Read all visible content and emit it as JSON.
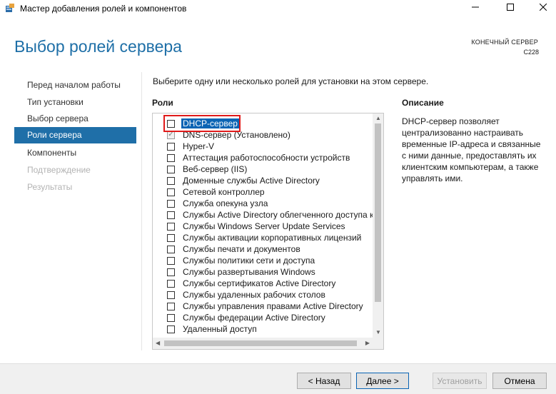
{
  "window": {
    "title": "Мастер добавления ролей и компонентов"
  },
  "header": {
    "title": "Выбор ролей сервера",
    "destination_label": "КОНЕЧНЫЙ СЕРВЕР",
    "destination_server": "C228"
  },
  "nav": {
    "items": [
      {
        "label": "Перед началом работы",
        "state": "normal"
      },
      {
        "label": "Тип установки",
        "state": "normal"
      },
      {
        "label": "Выбор сервера",
        "state": "normal"
      },
      {
        "label": "Роли сервера",
        "state": "selected"
      },
      {
        "label": "Компоненты",
        "state": "normal"
      },
      {
        "label": "Подтверждение",
        "state": "disabled"
      },
      {
        "label": "Результаты",
        "state": "disabled"
      }
    ]
  },
  "main": {
    "instruction": "Выберите одну или несколько ролей для установки на этом сервере.",
    "roles_heading": "Роли",
    "description_heading": "Описание",
    "description_text": "DHCP-сервер позволяет централизованно настраивать временные IP-адреса и связанные с ними данные, предоставлять их клиентским компьютерам, а также управлять ими.",
    "roles": [
      {
        "label": "DHCP-сервер",
        "checked": false,
        "selected": true
      },
      {
        "label": "DNS-сервер (Установлено)",
        "checked": true,
        "selected": false
      },
      {
        "label": "Hyper-V",
        "checked": false,
        "selected": false
      },
      {
        "label": "Аттестация работоспособности устройств",
        "checked": false,
        "selected": false
      },
      {
        "label": "Веб-сервер (IIS)",
        "checked": false,
        "selected": false
      },
      {
        "label": "Доменные службы Active Directory",
        "checked": false,
        "selected": false
      },
      {
        "label": "Сетевой контроллер",
        "checked": false,
        "selected": false
      },
      {
        "label": "Служба опекуна узла",
        "checked": false,
        "selected": false
      },
      {
        "label": "Службы Active Directory облегченного доступа к",
        "checked": false,
        "selected": false
      },
      {
        "label": "Службы Windows Server Update Services",
        "checked": false,
        "selected": false
      },
      {
        "label": "Службы активации корпоративных лицензий",
        "checked": false,
        "selected": false
      },
      {
        "label": "Службы печати и документов",
        "checked": false,
        "selected": false
      },
      {
        "label": "Службы политики сети и доступа",
        "checked": false,
        "selected": false
      },
      {
        "label": "Службы развертывания Windows",
        "checked": false,
        "selected": false
      },
      {
        "label": "Службы сертификатов Active Directory",
        "checked": false,
        "selected": false
      },
      {
        "label": "Службы удаленных рабочих столов",
        "checked": false,
        "selected": false
      },
      {
        "label": "Службы управления правами Active Directory",
        "checked": false,
        "selected": false
      },
      {
        "label": "Службы федерации Active Directory",
        "checked": false,
        "selected": false
      },
      {
        "label": "Удаленный доступ",
        "checked": false,
        "selected": false
      }
    ]
  },
  "footer": {
    "back_label": "< Назад",
    "next_label": "Далее >",
    "install_label": "Установить",
    "cancel_label": "Отмена"
  },
  "colors": {
    "accent": "#1f6fa8",
    "title_blue": "#1e6fa7",
    "selection": "#0a64b4",
    "highlight_red": "#e01a1a"
  },
  "icons": {
    "app": "server-manager-icon",
    "minimize": "minimize-icon",
    "maximize": "maximize-icon",
    "close": "close-icon",
    "checkmark": "checkmark-icon"
  }
}
